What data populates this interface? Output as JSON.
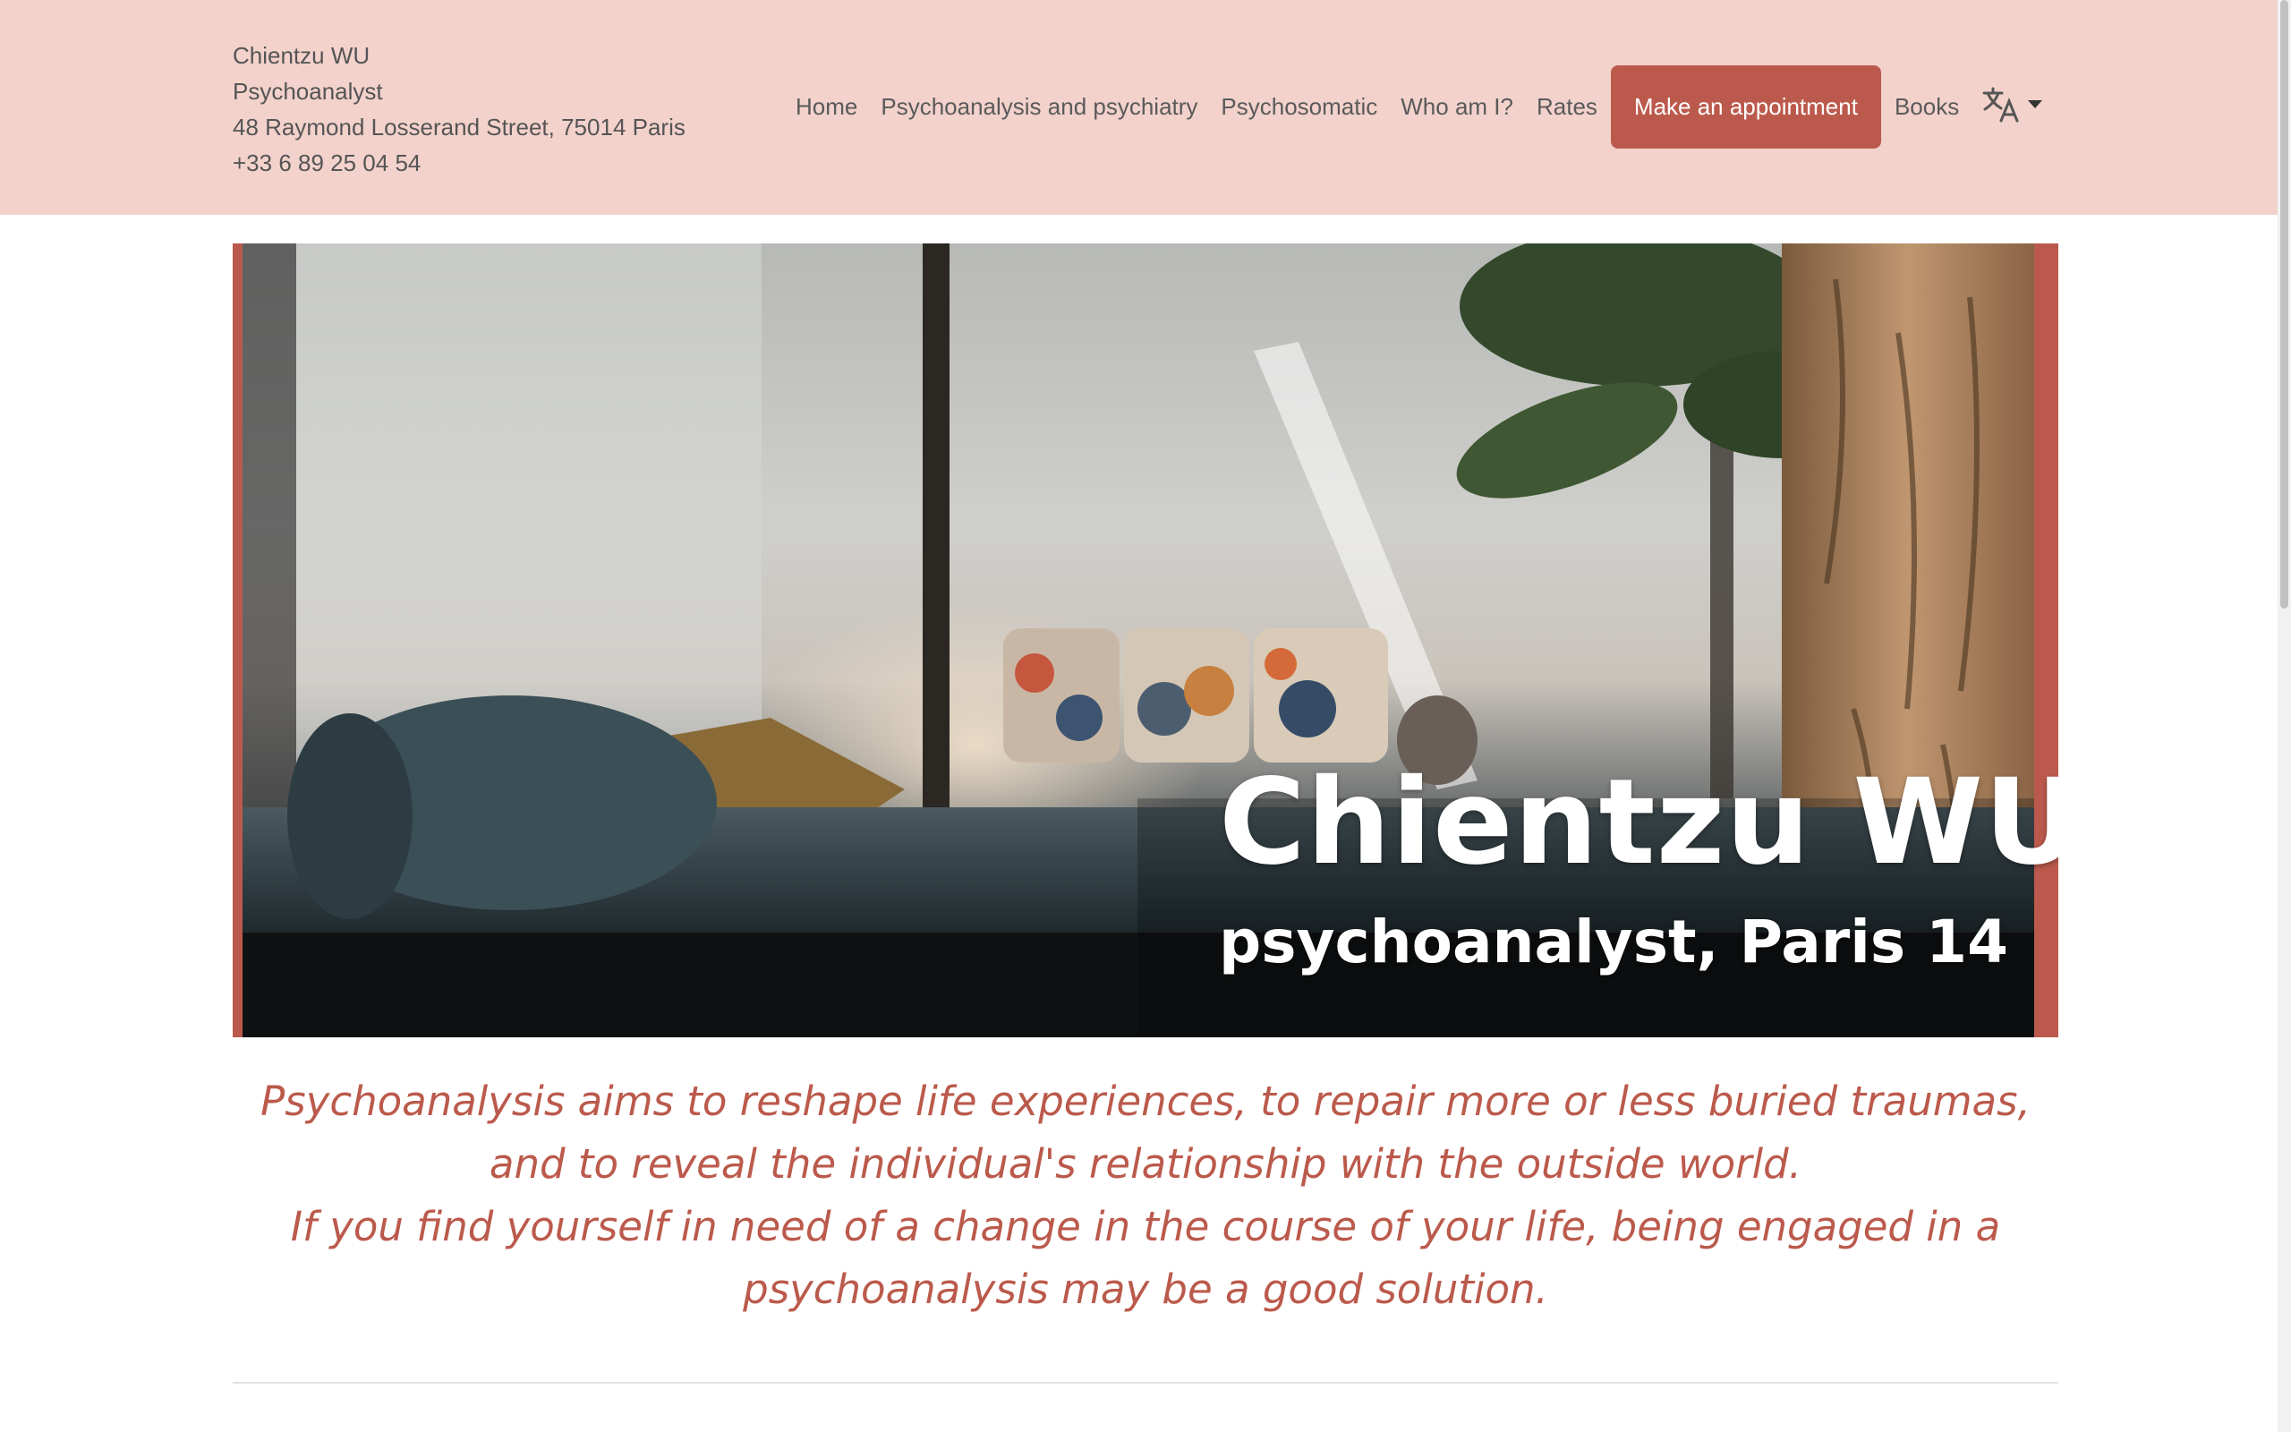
{
  "contact": {
    "name": "Chientzu WU",
    "profession": "Psychoanalyst",
    "address": "48 Raymond Losserand Street, 75014 Paris",
    "phone": "+33 6 89 25 04 54"
  },
  "nav": {
    "items": [
      "Home",
      "Psychoanalysis and psychiatry",
      "Psychosomatic",
      "Who am I?",
      "Rates"
    ],
    "cta": "Make an appointment",
    "books": "Books",
    "language_icon": "translate-icon"
  },
  "hero": {
    "title": "Chientzu WU",
    "subtitle": "psychoanalyst, Paris 14"
  },
  "intro": {
    "line1": "Psychoanalysis aims to reshape life experiences, to repair more or less buried traumas, and to reveal the individual's relationship with the outside world.",
    "line2": "If you find yourself in need of a change in the course of your life, being engaged in a psychoanalysis may be a good solution."
  },
  "colors": {
    "header_bg": "#f3d2cc",
    "accent": "#bb5a4c",
    "text": "#555555"
  }
}
